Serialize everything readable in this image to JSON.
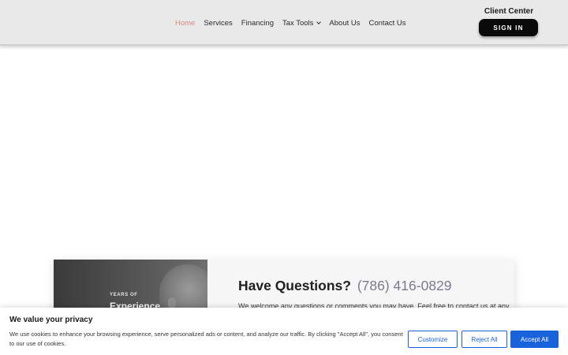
{
  "nav": {
    "items": [
      {
        "label": "Home",
        "active": true
      },
      {
        "label": "Services"
      },
      {
        "label": "Financing"
      },
      {
        "label": "Tax Tools",
        "has_dropdown": true
      },
      {
        "label": "About Us"
      },
      {
        "label": "Contact Us"
      }
    ]
  },
  "client": {
    "title": "Client Center",
    "signin_label": "SIGN IN"
  },
  "card": {
    "years_label": "YEARS OF",
    "experience_label": "Experience",
    "heading": "Have Questions?",
    "phone": "(786) 416-0829",
    "body": "We welcome any questions or comments you may have. Feel free to contact us at any"
  },
  "cookie": {
    "title": "We value your privacy",
    "text": "We use cookies to enhance your browsing experience, serve personalized ads or content, and analyze our traffic. By clicking \"Accept All\", you consent to our use of cookies.",
    "customize_label": "Customize",
    "reject_label": "Reject All",
    "accept_label": "Accept All"
  },
  "colors": {
    "accent_nav_active": "#d58b7e",
    "cookie_blue": "#1863dc",
    "phone_gray": "#7a7a90"
  }
}
